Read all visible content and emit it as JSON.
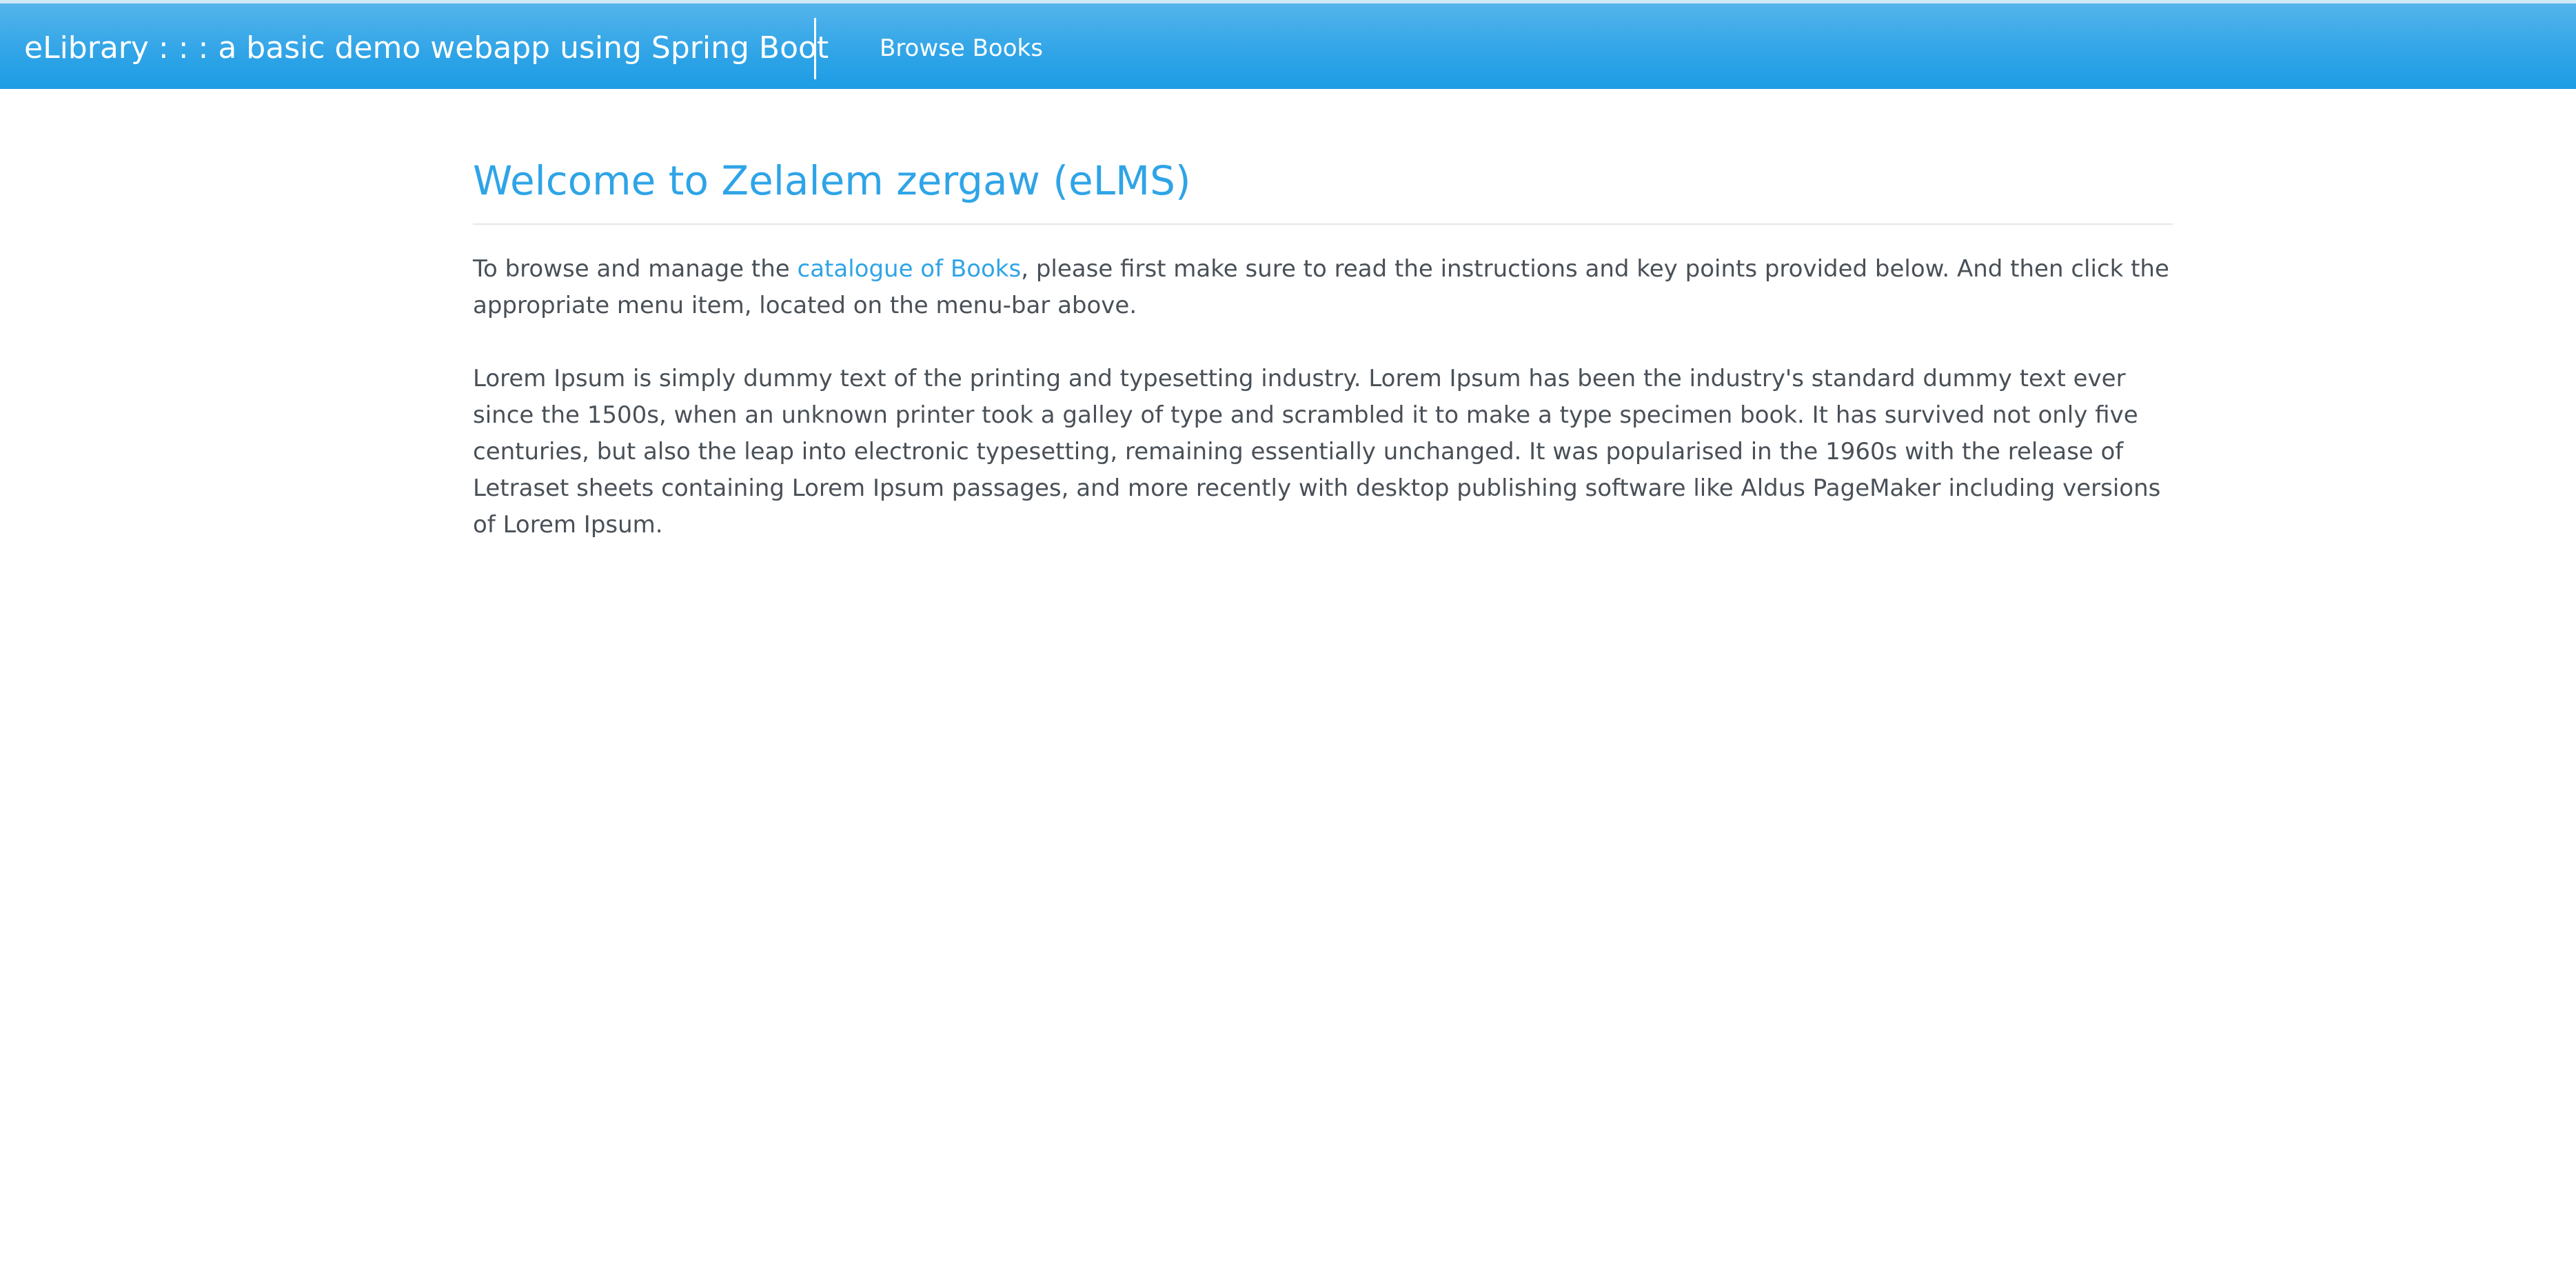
{
  "navbar": {
    "brand": "eLibrary : : : a basic demo webapp using Spring Boot",
    "links": [
      {
        "label": "Browse Books"
      }
    ]
  },
  "main": {
    "title": "Welcome to Zelalem zergaw (eLMS)",
    "intro": {
      "prefix": "To browse and manage the ",
      "link_text": "catalogue of Books",
      "suffix": ", please first make sure to read the instructions and key points provided below. And then click the appropriate menu item, located on the menu-bar above."
    },
    "body_paragraph": "Lorem Ipsum is simply dummy text of the printing and typesetting industry. Lorem Ipsum has been the industry's standard dummy text ever since the 1500s, when an unknown printer took a galley of type and scrambled it to make a type specimen book. It has survived not only five centuries, but also the leap into electronic typesetting, remaining essentially unchanged. It was popularised in the 1960s with the release of Letraset sheets containing Lorem Ipsum passages, and more recently with desktop publishing software like Aldus PageMaker including versions of Lorem Ipsum."
  },
  "colors": {
    "navbar": "#2fa4e7",
    "accent": "#2fa4e7",
    "text": "#495057"
  }
}
